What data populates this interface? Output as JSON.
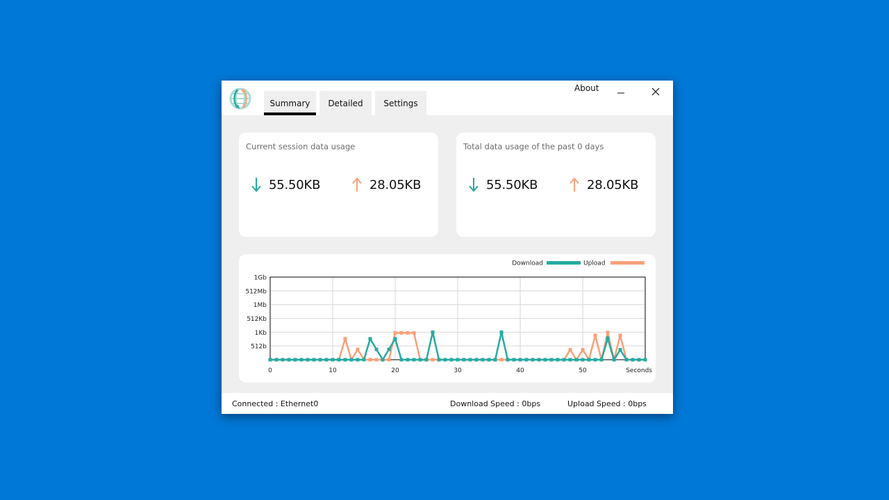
{
  "app": {
    "logo_icon": "globe-updown-arrows-icon",
    "tabs": [
      {
        "label": "Summary",
        "active": true
      },
      {
        "label": "Detailed",
        "active": false
      },
      {
        "label": "Settings",
        "active": false
      }
    ],
    "about_label": "About",
    "minimize_icon": "minimize-icon",
    "close_icon": "close-icon"
  },
  "colors": {
    "desktop": "#0078d7",
    "download": "#26aaa0",
    "upload": "#f9a07a",
    "grid": "#d6d6d6"
  },
  "cards": {
    "session": {
      "title": "Current session data usage",
      "download": "55.50KB",
      "upload": "28.05KB"
    },
    "total": {
      "title": "Total data usage of the past 0 days",
      "download": "55.50KB",
      "upload": "28.05KB"
    }
  },
  "chart_data": {
    "type": "line",
    "title": "",
    "xlabel": "Seconds",
    "ylabel": "",
    "x": [
      0,
      1,
      2,
      3,
      4,
      5,
      6,
      7,
      8,
      9,
      10,
      11,
      12,
      13,
      14,
      15,
      16,
      17,
      18,
      19,
      20,
      21,
      22,
      23,
      24,
      25,
      26,
      27,
      28,
      29,
      30,
      31,
      32,
      33,
      34,
      35,
      36,
      37,
      38,
      39,
      40,
      41,
      42,
      43,
      44,
      45,
      46,
      47,
      48,
      49,
      50,
      51,
      52,
      53,
      54,
      55,
      56,
      57,
      58,
      59,
      60
    ],
    "xlim": [
      0,
      60
    ],
    "x_ticks": [
      "0",
      "10",
      "20",
      "30",
      "40",
      "50"
    ],
    "y_ticks": [
      "512b",
      "1Kb",
      "512Kb",
      "1Mb",
      "512Mb",
      "1Gb"
    ],
    "y_tick_bytes": [
      0,
      512,
      1024,
      524288,
      1048576,
      536870912,
      1073741824
    ],
    "y_unit": "bytes",
    "grid": true,
    "legend": "top-right",
    "series": [
      {
        "name": "Download",
        "values": [
          0,
          0,
          0,
          0,
          0,
          0,
          0,
          0,
          0,
          0,
          0,
          0,
          0,
          0,
          0,
          0,
          778,
          384,
          0,
          384,
          778,
          0,
          0,
          0,
          0,
          0,
          1024,
          0,
          0,
          0,
          0,
          0,
          0,
          0,
          0,
          0,
          0,
          1024,
          0,
          0,
          0,
          0,
          0,
          0,
          0,
          0,
          0,
          0,
          0,
          0,
          0,
          0,
          0,
          0,
          794,
          0,
          369,
          0,
          0,
          0,
          0
        ]
      },
      {
        "name": "Upload",
        "values": [
          0,
          0,
          0,
          0,
          0,
          0,
          0,
          0,
          0,
          0,
          0,
          0,
          778,
          0,
          384,
          0,
          0,
          0,
          0,
          0,
          998,
          998,
          998,
          998,
          0,
          0,
          0,
          0,
          0,
          0,
          0,
          0,
          0,
          0,
          0,
          0,
          0,
          0,
          0,
          0,
          0,
          0,
          0,
          0,
          0,
          0,
          0,
          0,
          369,
          0,
          369,
          0,
          906,
          0,
          1014,
          0,
          906,
          0,
          0,
          0,
          0
        ]
      }
    ]
  },
  "status": {
    "connected": "Connected : Ethernet0",
    "download_speed": "Download Speed : 0bps",
    "upload_speed": "Upload Speed : 0bps"
  }
}
